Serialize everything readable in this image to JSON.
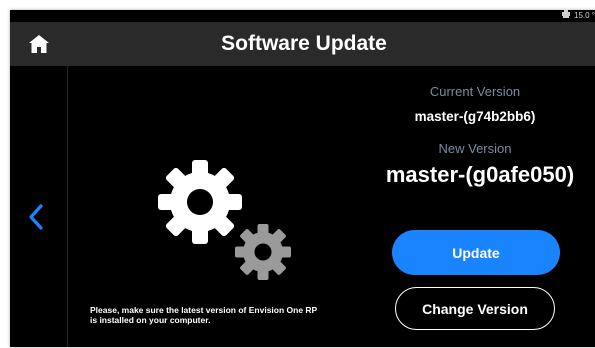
{
  "status_bar": {
    "temperature": "15.0 °",
    "icon": "printer-icon"
  },
  "header": {
    "title": "Software Update",
    "home_icon": "home-icon"
  },
  "nav": {
    "back_icon": "chevron-left-icon"
  },
  "illustration": {
    "icon": "gears-icon"
  },
  "versions": {
    "current_label": "Current Version",
    "current_value": "master-(g74b2bb6)",
    "new_label": "New Version",
    "new_value": "master-(g0afe050)"
  },
  "actions": {
    "update_label": "Update",
    "change_version_label": "Change Version"
  },
  "notice": {
    "line1": "Please, make sure the latest version of Envision One RP",
    "line2": "is installed on your computer."
  },
  "colors": {
    "background": "#000000",
    "header": "#2a2a2a",
    "accent": "#1a84ff",
    "label": "#7d8aa0"
  }
}
